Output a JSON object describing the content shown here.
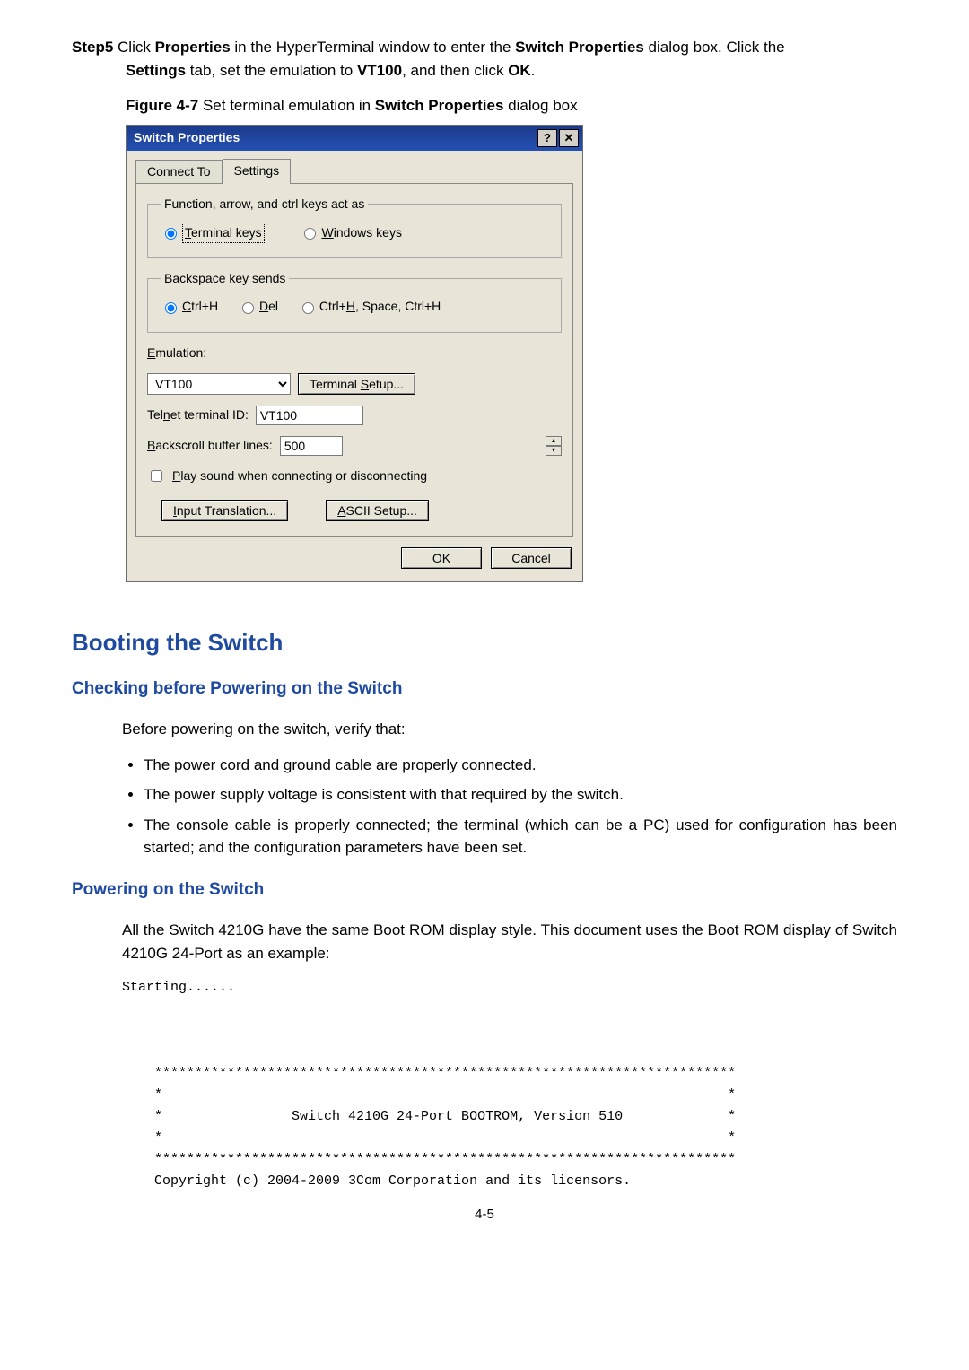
{
  "step5": {
    "label": "Step5",
    "line1a": " Click ",
    "b1": "Properties",
    "line1b": " in the HyperTerminal window to enter the ",
    "b2": "Switch Properties",
    "line1c": " dialog box. Click the ",
    "line2a": "Settings",
    "line2b": " tab, set the emulation to ",
    "b3": "VT100",
    "line2c": ", and then click ",
    "b4": "OK",
    "line2d": "."
  },
  "figcap": {
    "a": "Figure 4-7",
    "b": " Set terminal emulation in ",
    "c": "Switch Properties",
    "d": " dialog box"
  },
  "dialog": {
    "title": "Switch Properties",
    "tabs": {
      "connect": "Connect To",
      "settings": "Settings"
    },
    "group1": {
      "legend": "Function, arrow, and ctrl keys act as",
      "opt1_pre": "T",
      "opt1": "erminal keys",
      "opt2_pre": "W",
      "opt2": "indows keys"
    },
    "group2": {
      "legend": "Backspace key sends",
      "o1pre": "C",
      "o1": "trl+H",
      "o2pre": "D",
      "o2": "el",
      "o3a": "Ctrl+",
      "o3u": "H",
      "o3b": ", Space, Ctrl+H"
    },
    "emu": {
      "label_pre": "E",
      "label": "mulation:",
      "value": "VT100",
      "btn_a": "Terminal ",
      "btn_u": "S",
      "btn_b": "etup..."
    },
    "telnet": {
      "label_a": "Tel",
      "label_u": "n",
      "label_b": "et terminal ID:",
      "value": "VT100"
    },
    "back": {
      "label_u": "B",
      "label": "ackscroll buffer lines:",
      "value": "500"
    },
    "play": {
      "u": "P",
      "rest": "lay sound when connecting or disconnecting"
    },
    "inputtrans": {
      "u": "I",
      "rest": "nput Translation..."
    },
    "ascii": {
      "u": "A",
      "rest": "SCII Setup..."
    },
    "ok": "OK",
    "cancel": "Cancel"
  },
  "h_boot": "Booting the Switch",
  "h_check": "Checking before Powering on the Switch",
  "p_before": "Before powering on the switch, verify that:",
  "bullets": [
    "The power cord and ground cable are properly connected.",
    "The power supply voltage is consistent with that required by the switch.",
    "The console cable is properly connected; the terminal (which can be a PC) used for configuration has been started; and the configuration parameters have been set."
  ],
  "h_power": "Powering on the Switch",
  "p_allsw": "All the Switch 4210G have the same Boot ROM display style. This document uses the Boot ROM display of Switch 4210G 24-Port as an example:",
  "term": "Starting......\n\n\n\n    ************************************************************************\n    *                                                                      *\n    *                Switch 4210G 24-Port BOOTROM, Version 510             *\n    *                                                                      *\n    ************************************************************************\n    Copyright (c) 2004-2009 3Com Corporation and its licensors.",
  "pagenum": "4-5",
  "chart_data": null
}
